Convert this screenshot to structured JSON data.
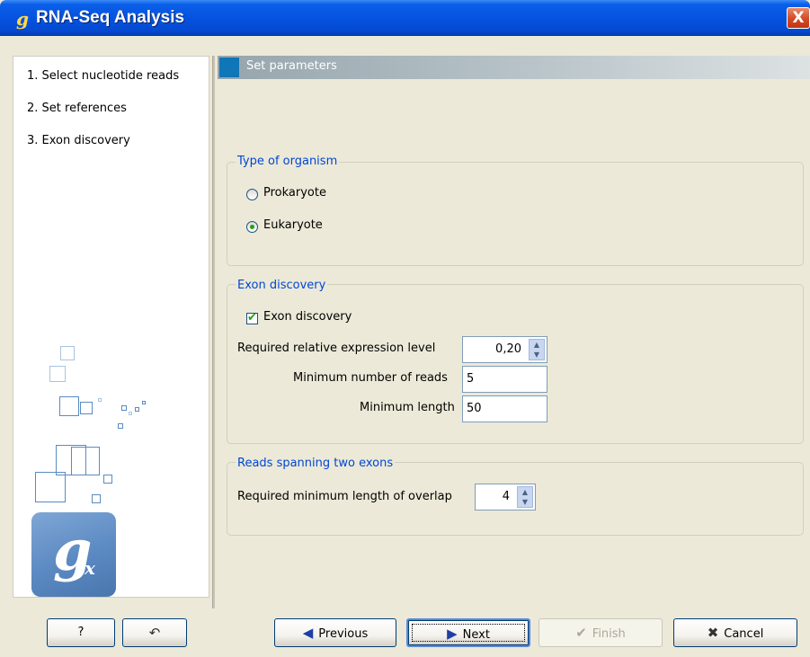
{
  "window": {
    "title": "RNA-Seq Analysis",
    "logo_glyph": "g",
    "close_glyph": "X"
  },
  "sidebar": {
    "steps": [
      {
        "label": "1.  Select nucleotide reads"
      },
      {
        "label": "2.  Set references"
      },
      {
        "label": "3.  Exon discovery"
      }
    ],
    "logo": {
      "letter": "g",
      "subscript": "x"
    }
  },
  "panel": {
    "header": "Set parameters",
    "organism": {
      "legend": "Type of organism",
      "options": [
        {
          "label": "Prokaryote",
          "selected": false
        },
        {
          "label": "Eukaryote",
          "selected": true
        }
      ]
    },
    "exon": {
      "legend": "Exon discovery",
      "checkbox_label": "Exon discovery",
      "checked": true,
      "expression_label": "Required relative expression level",
      "expression_value": "0,20",
      "min_reads_label": "Minimum number of reads",
      "min_reads_value": "5",
      "min_length_label": "Minimum length",
      "min_length_value": "50"
    },
    "spanning": {
      "legend": "Reads spanning two exons",
      "overlap_label": "Required minimum length of overlap",
      "overlap_value": "4"
    }
  },
  "buttons": {
    "help": "?",
    "previous": "Previous",
    "next": "Next",
    "finish": "Finish",
    "cancel": "Cancel"
  },
  "colors": {
    "title_bar": "#0553e0",
    "legend_text": "#0046d5",
    "header_accent": "#0f76b7"
  }
}
